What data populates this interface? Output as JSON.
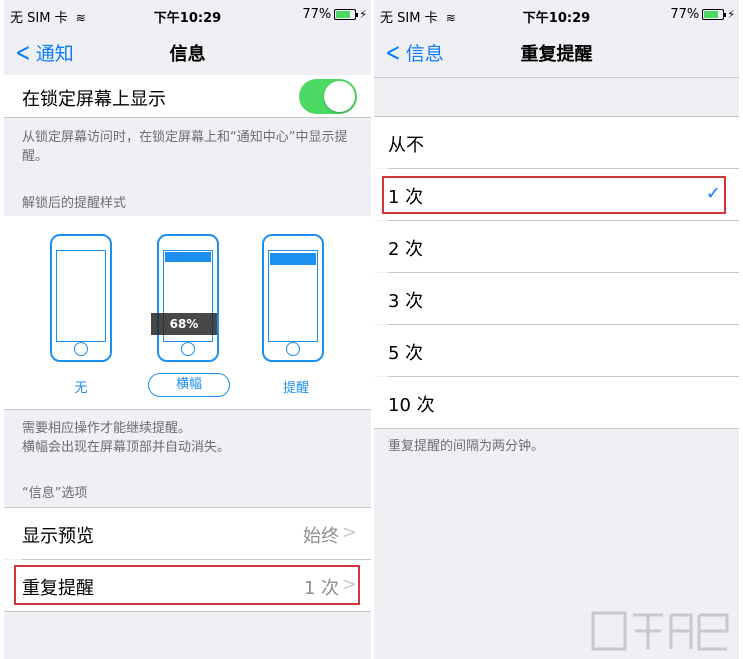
{
  "left": {
    "status": {
      "carrier": "无 SIM 卡",
      "time": "下午10:29",
      "battery": "77%",
      "battery_level": 0.77
    },
    "nav": {
      "back": "通知",
      "title": "信息"
    },
    "lock_screen_row": {
      "label": "在锁定屏幕上显示",
      "enabled": true
    },
    "lock_screen_note": "从锁定屏幕访问时，在锁定屏幕上和“通知中心”中显示提醒。",
    "alert_style_header": "解锁后的提醒样式",
    "alert_styles": [
      {
        "label": "无"
      },
      {
        "label": "横幅",
        "selected": true
      },
      {
        "label": "提醒"
      }
    ],
    "zoom_badge": "68%",
    "alert_style_note_1": "需要相应操作才能继续提醒。",
    "alert_style_note_2": "横幅会出现在屏幕顶部并自动消失。",
    "options_header": "“信息”选项",
    "show_preview": {
      "label": "显示预览",
      "value": "始终"
    },
    "repeat_alerts": {
      "label": "重复提醒",
      "value": "1 次"
    }
  },
  "right": {
    "status": {
      "carrier": "无 SIM 卡",
      "time": "下午10:29",
      "battery": "77%",
      "battery_level": 0.77
    },
    "nav": {
      "back": "信息",
      "title": "重复提醒"
    },
    "options": [
      {
        "label": "从不",
        "selected": false
      },
      {
        "label": "1 次",
        "selected": true
      },
      {
        "label": "2 次",
        "selected": false
      },
      {
        "label": "3 次",
        "selected": false
      },
      {
        "label": "5 次",
        "selected": false
      },
      {
        "label": "10 次",
        "selected": false
      }
    ],
    "footer_note": "重复提醒的间隔为两分钟。"
  },
  "colors": {
    "accent": "#0a7cff",
    "toggle_on": "#4cd964",
    "highlight": "#d0383a",
    "phone_outline": "#1d8ff0"
  }
}
